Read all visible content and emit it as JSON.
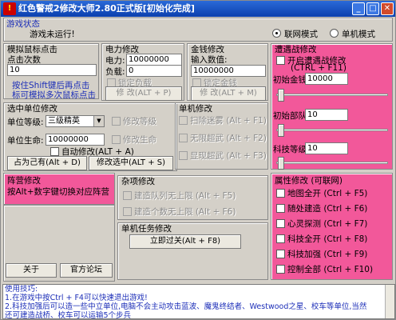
{
  "window": {
    "title": "红色警戒2修改大师2.80正式版[初始化完成]",
    "app_icon": "alert-icon"
  },
  "status": {
    "group_label": "游戏状态",
    "text": "游戏未运行!",
    "mode_online": "联网模式",
    "mode_single": "单机模式",
    "selected": "联网模式"
  },
  "mouse_sim": {
    "title": "模拟鼠标点击",
    "clicks_label": "点击次数",
    "clicks_value": "10",
    "hint_line1": "按住Shift键后再点击",
    "hint_line2": "标可模拟多次鼠标点击"
  },
  "power": {
    "title": "电力修改",
    "power_label": "电力:",
    "power_value": "10000000",
    "load_label": "负载:",
    "load_value": "0",
    "lock_label": "锁定负载",
    "button": "修 改(ALT + P)"
  },
  "money": {
    "title": "金钱修改",
    "input_label": "输入数值:",
    "input_value": "10000000",
    "lock_label": "锁定金钱",
    "button": "修 改(ALT + M)"
  },
  "online_mod": {
    "title": "遭遇战修改",
    "enable_label": "开启遭遇战修改",
    "enable_hotkey": "(CTRL + F11)",
    "init_money_label": "初始金钱",
    "init_money_value": "10000",
    "init_units_label": "初始部队",
    "init_units_value": "10",
    "tech_label": "科技等级",
    "tech_value": "10"
  },
  "unit_mod": {
    "title": "选中单位修改",
    "level_label": "单位等级:",
    "level_value": "三级精英",
    "life_label": "单位生命:",
    "life_value": "10000000",
    "auto_label": "自动修改(ALT + A)",
    "mod_level_label": "修改等级",
    "mod_life_label": "修改生命",
    "occupy_button": "占为己有(Alt + D)",
    "modify_button": "修改选中(ALT + S)"
  },
  "single_mod": {
    "title": "单机修改",
    "items": [
      {
        "label": "扫除迷雾 (Alt + F1)"
      },
      {
        "label": "无限超武 (Alt + F2)"
      },
      {
        "label": "显现超武 (Alt + F3)"
      }
    ]
  },
  "camp": {
    "title": "阵营修改",
    "hint": "按Alt+数字键切换对应阵营"
  },
  "misc": {
    "title": "杂项修改",
    "items": [
      {
        "label": "建造队列无上限 (Alt + F5)"
      },
      {
        "label": "建造个数无上限 (Alt + F6)"
      }
    ]
  },
  "mission": {
    "title": "单机任务修改",
    "button": "立即过关(Alt + F8)"
  },
  "attributes": {
    "title": "属性修改 (可联网)",
    "items": [
      {
        "label": "地图全开 (Ctrl + F5)"
      },
      {
        "label": "随处建造 (Ctrl + F6)"
      },
      {
        "label": "心灵探测 (Ctrl + F7)"
      },
      {
        "label": "科技全开 (Ctrl + F8)"
      },
      {
        "label": "科技加强 (Ctrl + F9)"
      },
      {
        "label": "控制全部 (Ctrl + F10)"
      }
    ]
  },
  "footer_buttons": {
    "about": "关于",
    "forum": "官方论坛"
  },
  "tips": {
    "lines": [
      "使用技巧:",
      "1.在游戏中按Ctrl + F4可以快速退出游戏!",
      "2.科技加强后可以造一些中立单位,电脑不会主动攻击蓝波、魔鬼终结者、Westwood之星、校车等单位,当然",
      "还可建造战桥、校车可以运输5个步兵"
    ]
  },
  "colors": {
    "pink_panel": "#f2589a",
    "hint_blue": "#1d2fb8",
    "title_blue": "#0b3fae"
  }
}
